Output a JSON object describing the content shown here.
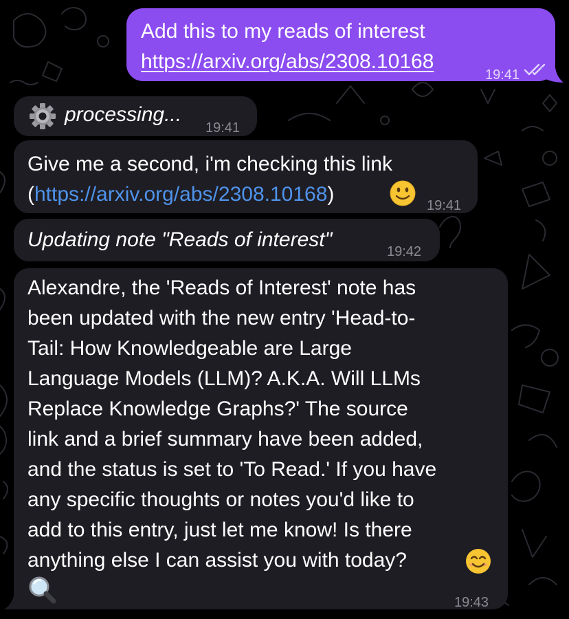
{
  "messages": [
    {
      "direction": "outgoing",
      "line1": "Add this to my reads of interest",
      "link": "https://arxiv.org/abs/2308.10168",
      "time": "19:41",
      "read_status": "double-check-icon"
    },
    {
      "direction": "incoming",
      "icon": "gear-icon",
      "text": "processing...",
      "time": "19:41"
    },
    {
      "direction": "incoming",
      "line1": "Give me a second, i'm checking this link",
      "line2_open": "(",
      "link": "https://arxiv.org/abs/2308.10168",
      "line2_close": ")",
      "emoji": "slightly-smiling-face-icon",
      "time": "19:41"
    },
    {
      "direction": "incoming",
      "text": "Updating note \"Reads of interest\"",
      "time": "19:42"
    },
    {
      "direction": "incoming",
      "lines": [
        "Alexandre, the 'Reads of Interest' note has",
        "been updated with the new entry 'Head-to-",
        "Tail: How Knowledgeable are Large",
        "Language Models (LLM)? A.K.A. Will LLMs",
        "Replace Knowledge Graphs?' The source",
        "link and a brief summary have been added,",
        "and the status is set to 'To Read.' If you have",
        "any specific thoughts or notes you'd like to",
        "add to this entry, just let me know! Is there",
        "anything else I can assist you with today?"
      ],
      "emojis": [
        "smiling-face-icon",
        "magnifying-glass-icon"
      ],
      "time": "19:43"
    }
  ],
  "colors": {
    "background": "#000000",
    "incoming_bubble": "#1e1d24",
    "outgoing_bubble": "#8b4cf0",
    "link": "#4f93ea",
    "timestamp": "#8b8a91"
  }
}
